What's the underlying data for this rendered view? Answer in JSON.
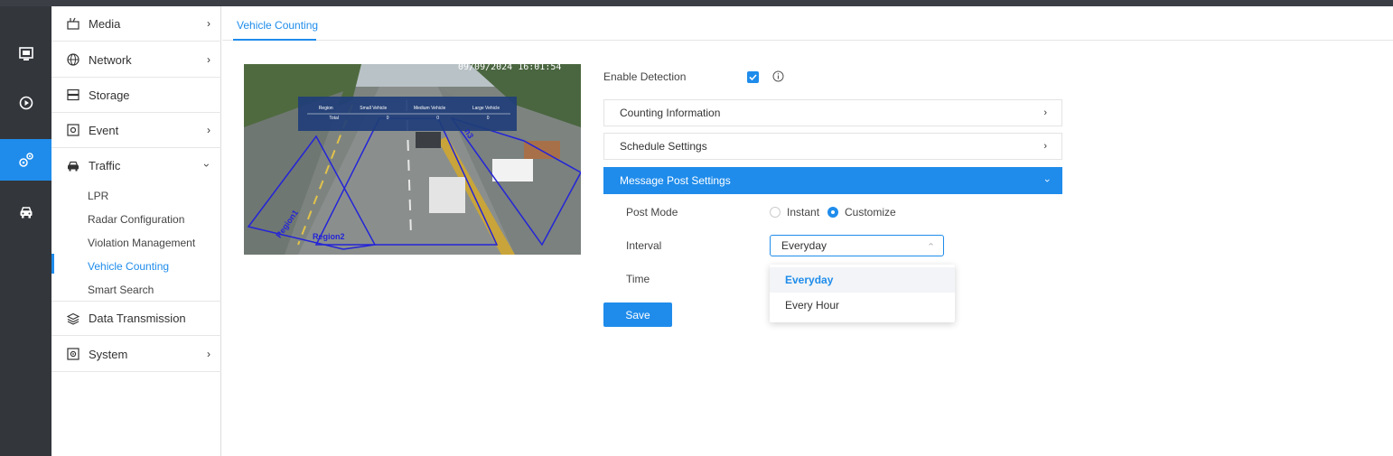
{
  "sidebar": {
    "items": [
      {
        "label": "Media",
        "icon": "media-icon"
      },
      {
        "label": "Network",
        "icon": "globe-icon"
      },
      {
        "label": "Storage",
        "icon": "storage-icon"
      },
      {
        "label": "Event",
        "icon": "event-icon"
      },
      {
        "label": "Traffic",
        "icon": "car-icon"
      },
      {
        "label": "Data Transmission",
        "icon": "layers-icon"
      },
      {
        "label": "System",
        "icon": "system-icon"
      }
    ],
    "traffic_sub": [
      "LPR",
      "Radar Configuration",
      "Violation Management",
      "Vehicle Counting",
      "Smart Search"
    ]
  },
  "tab": {
    "label": "Vehicle Counting"
  },
  "camera": {
    "timestamp": "09/09/2024 16:01:54",
    "overlay_headers": [
      "Region",
      "Small Vehicle",
      "Medium Vehicle",
      "Large Vehicle"
    ],
    "overlay_row": [
      "Total",
      "0",
      "0",
      "0"
    ],
    "regions": [
      "Region1",
      "Region2",
      "n3"
    ]
  },
  "form": {
    "enable_detection_label": "Enable Detection",
    "enable_detection_checked": true,
    "panels": [
      "Counting Information",
      "Schedule Settings",
      "Message Post Settings"
    ],
    "post_mode_label": "Post Mode",
    "post_mode_options": [
      "Instant",
      "Customize"
    ],
    "post_mode_selected": "Customize",
    "interval_label": "Interval",
    "interval_value": "Everyday",
    "time_label": "Time",
    "interval_options": [
      "Everyday",
      "Every Hour"
    ],
    "save_label": "Save"
  },
  "colors": {
    "accent": "#1f8ceb",
    "iconbar": "#33363b"
  }
}
